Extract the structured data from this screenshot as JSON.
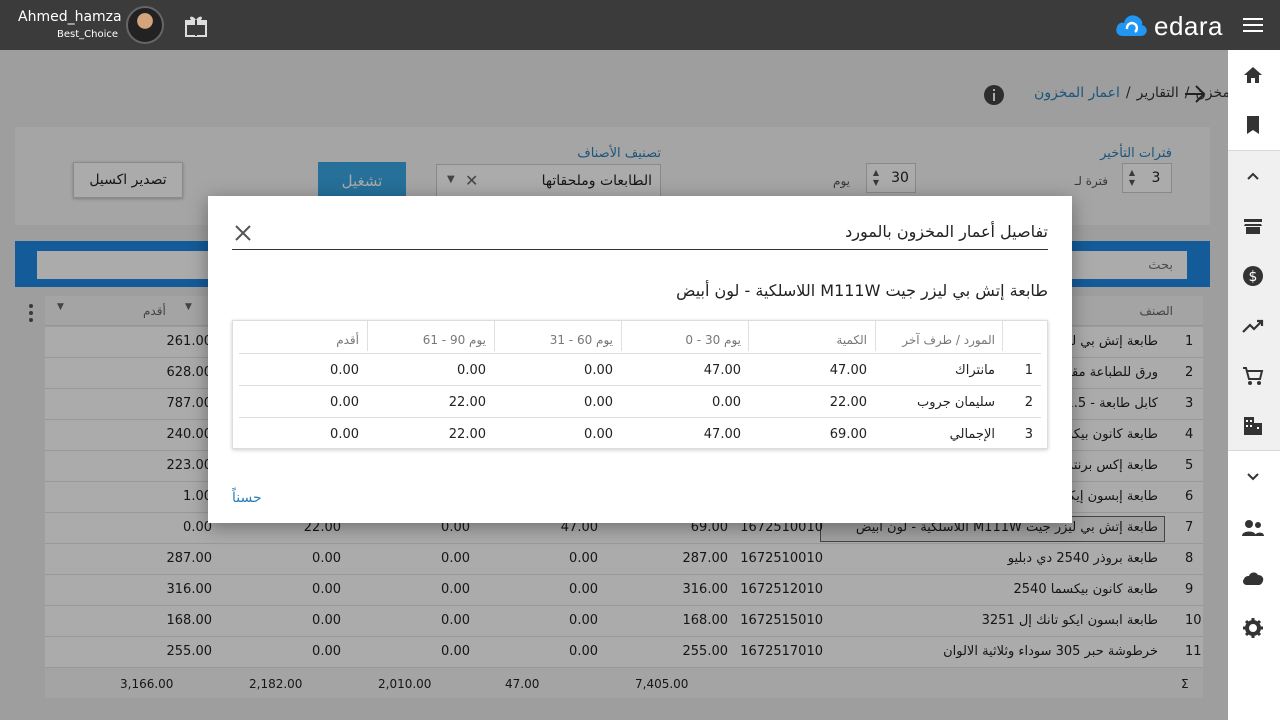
{
  "topbar": {
    "user_name": "Ahmed_hamza",
    "company": "Best_Choice",
    "logo_text": "edara",
    "brand_color": "#1e88e5"
  },
  "sidebar": {
    "icons": [
      "home-icon",
      "bookmark-icon",
      "chevron-up-icon",
      "store-icon",
      "dollar-icon",
      "trending-up-icon",
      "cart-icon",
      "building-icon",
      "chevron-down-icon",
      "people-icon",
      "cloud-icon",
      "gear-icon"
    ]
  },
  "breadcrumb": {
    "items": [
      "مخزن",
      "التقارير"
    ],
    "separator": "/",
    "current": "اعمار المخزون"
  },
  "filters": {
    "delay_periods_label": "فترات التأخير",
    "delay_periods_value": "3",
    "period_label": "فترة لـ",
    "days_value": "30",
    "days_unit": "يوم",
    "category_label": "تصنيف الأصناف",
    "category_value": "الطابعات وملحقاتها",
    "run_label": "تشغيل",
    "export_label": "تصدير اكسيل"
  },
  "search": {
    "placeholder": "بحث"
  },
  "grid": {
    "headers": {
      "item": "الصنف",
      "oldest": "أقدم"
    },
    "rows": [
      {
        "idx": "1",
        "name": "طابعة إتش بي ليزر جيت",
        "code": "",
        "qty": "",
        "d0_30": "",
        "d31_60": "",
        "d61_90": "",
        "oldest": "261.00"
      },
      {
        "idx": "2",
        "name": "ورق للطباعة مقاس",
        "code": "",
        "qty": "",
        "d0_30": "",
        "d31_60": "",
        "d61_90": "",
        "oldest": "628.00"
      },
      {
        "idx": "3",
        "name": "كابل طابعة - 1.5",
        "code": "",
        "qty": "",
        "d0_30": "",
        "d31_60": "",
        "d61_90": "",
        "oldest": "787.00"
      },
      {
        "idx": "4",
        "name": "طابعة كانون بيكسما",
        "code": "",
        "qty": "",
        "d0_30": "",
        "d31_60": "",
        "d61_90": "",
        "oldest": "240.00"
      },
      {
        "idx": "5",
        "name": "طابعة إكس برنتر",
        "code": "",
        "qty": "",
        "d0_30": "",
        "d31_60": "",
        "d61_90": "",
        "oldest": "223.00"
      },
      {
        "idx": "6",
        "name": "طابعة إبسون إيكو",
        "code": "",
        "qty": "",
        "d0_30": "",
        "d31_60": "",
        "d61_90": "",
        "oldest": "1.00"
      },
      {
        "idx": "7",
        "name": "طابعة إتش بي ليزر جيت M111W اللاسلكية - لون أبيض",
        "code": "1672510010",
        "qty": "69.00",
        "d0_30": "47.00",
        "d31_60": "0.00",
        "d61_90": "22.00",
        "oldest": "0.00"
      },
      {
        "idx": "8",
        "name": "طابعة بروذر 2540 دي دبليو",
        "code": "1672510010",
        "qty": "287.00",
        "d0_30": "0.00",
        "d31_60": "0.00",
        "d61_90": "0.00",
        "oldest": "287.00"
      },
      {
        "idx": "9",
        "name": "طابعة كانون بيكسما 2540",
        "code": "1672512010",
        "qty": "316.00",
        "d0_30": "0.00",
        "d31_60": "0.00",
        "d61_90": "0.00",
        "oldest": "316.00"
      },
      {
        "idx": "10",
        "name": "طابعة ابسون ايكو تانك إل 3251",
        "code": "1672515010",
        "qty": "168.00",
        "d0_30": "0.00",
        "d31_60": "0.00",
        "d61_90": "0.00",
        "oldest": "168.00"
      },
      {
        "idx": "11",
        "name": "خرطوشة حبر 305 سوداء وثلاثية الالوان",
        "code": "1672517010",
        "qty": "255.00",
        "d0_30": "0.00",
        "d31_60": "0.00",
        "d61_90": "0.00",
        "oldest": "255.00"
      }
    ],
    "footer": {
      "sigma": "Σ",
      "qty": "7,405.00",
      "d0_30": "47.00",
      "d31_60": "2,010.00",
      "d61_90": "2,182.00",
      "oldest": "3,166.00"
    }
  },
  "modal": {
    "title": "تفاصيل أعمار المخزون بالمورد",
    "subtitle": "طابعة إتش بي ليزر جيت M111W اللاسلكية - لون أبيض",
    "headers": {
      "supplier": "المورد / طرف آخر",
      "qty": "الكمية",
      "d0_30": "0 - 30 يوم",
      "d31_60": "31 - 60 يوم",
      "d61_90": "61 - 90 يوم",
      "oldest": "أقدم"
    },
    "rows": [
      {
        "idx": "1",
        "supplier": "مانتراك",
        "qty": "47.00",
        "d0_30": "47.00",
        "d31_60": "0.00",
        "d61_90": "0.00",
        "oldest": "0.00"
      },
      {
        "idx": "2",
        "supplier": "سليمان جروب",
        "qty": "22.00",
        "d0_30": "0.00",
        "d31_60": "0.00",
        "d61_90": "22.00",
        "oldest": "0.00"
      },
      {
        "idx": "3",
        "supplier": "الإجمالي",
        "qty": "69.00",
        "d0_30": "47.00",
        "d31_60": "0.00",
        "d61_90": "22.00",
        "oldest": "0.00"
      }
    ],
    "ok_label": "حسناً"
  }
}
